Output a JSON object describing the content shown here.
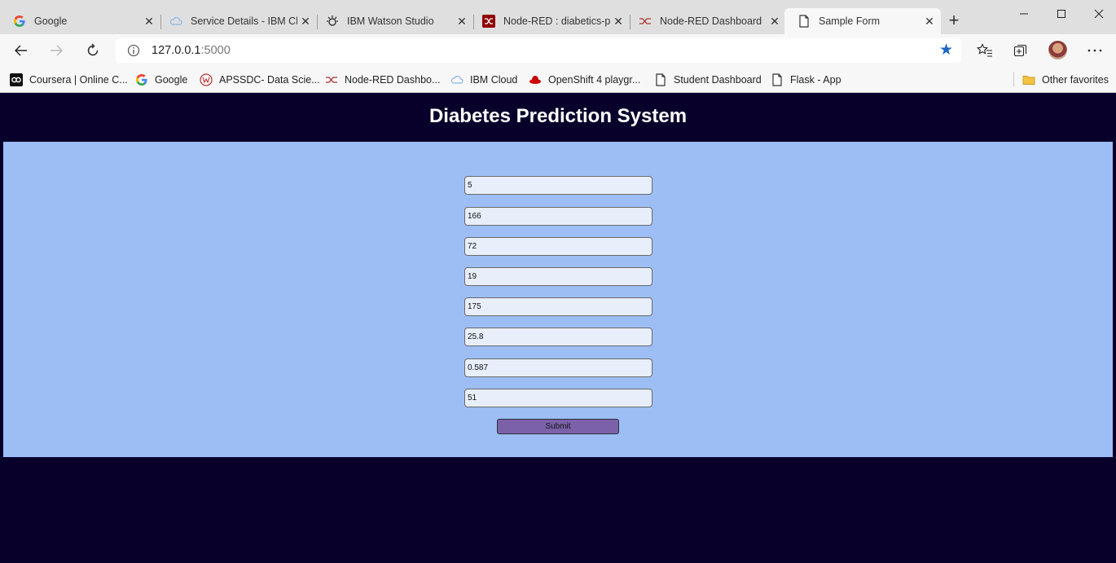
{
  "browser": {
    "tabs": [
      {
        "label": "Google",
        "icon": "google-icon",
        "active": false
      },
      {
        "label": "Service Details - IBM Cl",
        "icon": "ibm-cloud-icon",
        "active": false
      },
      {
        "label": "IBM Watson Studio",
        "icon": "watson-icon",
        "active": false
      },
      {
        "label": "Node-RED : diabetics-p",
        "icon": "node-red-icon",
        "active": false
      },
      {
        "label": "Node-RED Dashboard",
        "icon": "node-red-dashboard-icon",
        "active": false
      },
      {
        "label": "Sample Form",
        "icon": "page-icon",
        "active": true
      }
    ],
    "address": {
      "host": "127.0.0.1",
      "port": ":5000"
    },
    "favorites": [
      {
        "label": "Coursera | Online C...",
        "icon": "coursera-icon"
      },
      {
        "label": "Google",
        "icon": "google-icon"
      },
      {
        "label": "APSSDC- Data Scie...",
        "icon": "apssdc-icon"
      },
      {
        "label": "Node-RED Dashbo...",
        "icon": "node-red-dashboard-icon"
      },
      {
        "label": "IBM Cloud",
        "icon": "ibm-cloud-icon"
      },
      {
        "label": "OpenShift 4 playgr...",
        "icon": "redhat-icon"
      },
      {
        "label": "Student Dashboard",
        "icon": "page-icon"
      },
      {
        "label": "Flask - App",
        "icon": "page-icon"
      }
    ],
    "other_favorites": "Other favorites",
    "colors": {
      "accent": "#1b68c6"
    }
  },
  "page": {
    "title": "Diabetes Prediction System",
    "fields": [
      "5",
      "166",
      "72",
      "19",
      "175",
      "25.8",
      "0.587",
      "51"
    ],
    "submit_label": "Submit",
    "colors": {
      "background": "#08002b",
      "panel": "#9dbef4",
      "button": "#7b62a8"
    }
  }
}
